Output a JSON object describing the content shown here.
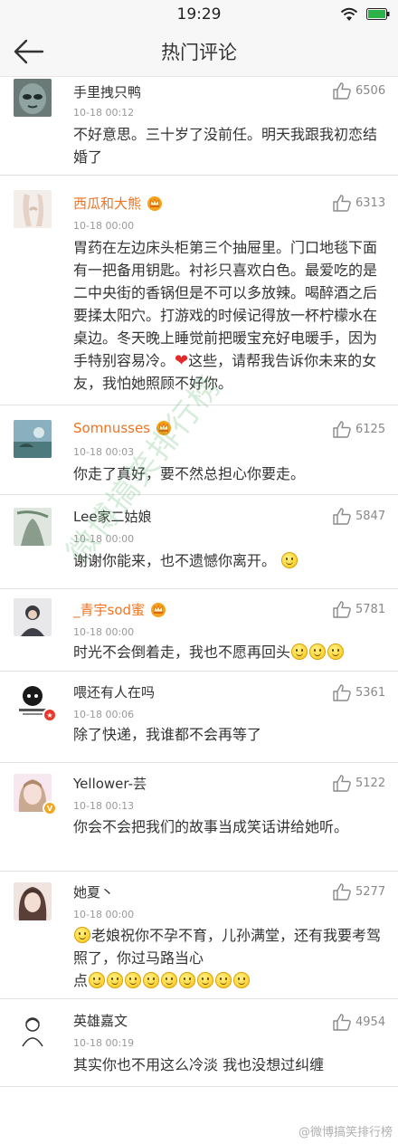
{
  "status": {
    "time": "19:29"
  },
  "nav": {
    "title": "热门评论"
  },
  "comments": [
    {
      "name": "手里拽只鸭",
      "vip": false,
      "time": "10-18 00:12",
      "likes": "6506",
      "text": "不好意思。三十岁了没前任。明天我跟我初恋结婚了"
    },
    {
      "name": "西瓜和大熊",
      "vip": true,
      "time": "10-18 00:00",
      "likes": "6313",
      "text1": "胃药在左边床头柜第三个抽屉里。门口地毯下面有一把备用钥匙。衬衫只喜欢白色。最爱吃的是二中央街的香锅但是不可以多放辣。喝醉酒之后要揉太阳穴。打游戏的时候记得放一杯柠檬水在桌边。冬天晚上睡觉前把暖宝充好电暖手，因为手特别容易冷。",
      "heart": "❤",
      "text2": "这些，请帮我告诉你未来的女友，我怕她照顾不好你。"
    },
    {
      "name": "Somnusses",
      "vip": true,
      "time": "10-18 00:03",
      "likes": "6125",
      "text": "你走了真好，要不然总担心你要走。"
    },
    {
      "name": "Lee家二姑娘",
      "vip": false,
      "time": "10-18 00:00",
      "likes": "5847",
      "text": "谢谢你能来，也不遗憾你离开。"
    },
    {
      "name": "_青宇sod蜜",
      "vip": true,
      "time": "10-18 00:00",
      "likes": "5781",
      "text": "时光不会倒着走，我也不愿再回头"
    },
    {
      "name": "喂还有人在吗",
      "vip": false,
      "time": "10-18 00:06",
      "likes": "5361",
      "text": "除了快递，我谁都不会再等了"
    },
    {
      "name": "Yellower-芸",
      "vip": false,
      "time": "10-18 00:13",
      "likes": "5122",
      "text": "你会不会把我们的故事当成笑话讲给她听。"
    },
    {
      "name": "她夏丶",
      "vip": false,
      "time": "10-18 00:00",
      "likes": "5277",
      "text1": "老娘祝你不孕不育，儿孙满堂，还有我要考驾照了，你过马路当心",
      "text2": "点"
    },
    {
      "name": "英雄嘉文",
      "vip": false,
      "time": "10-18 00:19",
      "likes": "4954",
      "text": "其实你也不用这么冷淡 我也没想过纠缠"
    }
  ],
  "watermark": "微博搞笑排行榜",
  "credit": "@微博搞笑排行榜",
  "icons": {
    "back": "back-arrow-icon",
    "like": "thumbs-up-icon",
    "crown": "vip-crown-icon",
    "emoji": "smiley-emoji-icon"
  }
}
